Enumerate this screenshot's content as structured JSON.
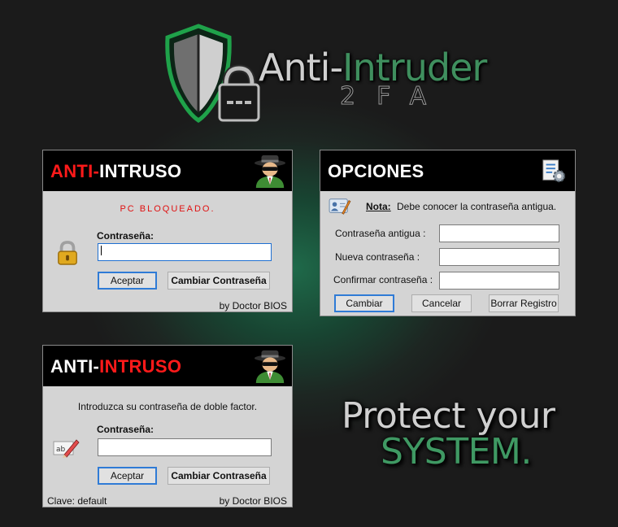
{
  "header": {
    "title_part1": "Anti-",
    "title_part2": "Intruder",
    "subtitle": "2FA"
  },
  "login_window": {
    "title_part1": "ANTI-",
    "title_part2": "INTRUSO",
    "status": "PC BLOQUEADO.",
    "password_label": "Contraseña:",
    "password_value": "",
    "accept_button": "Aceptar",
    "change_password_button": "Cambiar Contraseña",
    "credit": "by Doctor BIOS",
    "avatar_icon": "spy-agent-icon",
    "lock_icon": "padlock-icon"
  },
  "options_window": {
    "title": "OPCIONES",
    "note_label": "Nota:",
    "note_text": "Debe conocer la contraseña antigua.",
    "old_password_label": "Contraseña antigua :",
    "new_password_label": "Nueva contraseña :",
    "confirm_password_label": "Confirmar contraseña :",
    "old_password_value": "",
    "new_password_value": "",
    "confirm_password_value": "",
    "change_button": "Cambiar",
    "cancel_button": "Cancelar",
    "delete_registry_button": "Borrar Registro",
    "settings_icon": "document-gear-icon",
    "note_icon": "contact-card-pencil-icon"
  },
  "twofa_window": {
    "title_part1": "ANTI-",
    "title_part2": "INTRUSO",
    "instruction": "Introduzca su contraseña de doble factor.",
    "password_label": "Contraseña:",
    "password_value": "",
    "accept_button": "Aceptar",
    "change_password_button": "Cambiar Contraseña",
    "key_hint": "Clave: default",
    "credit": "by Doctor BIOS",
    "avatar_icon": "spy-agent-icon",
    "edit_icon": "text-edit-pencil-icon"
  },
  "tagline": {
    "line1": "Protect your",
    "line2": "SYSTEM."
  },
  "colors": {
    "accent_green": "#3f9963",
    "title_red": "#ff1a1a",
    "focus_blue": "#2f7bd6",
    "window_bg": "#d4d4d4"
  }
}
